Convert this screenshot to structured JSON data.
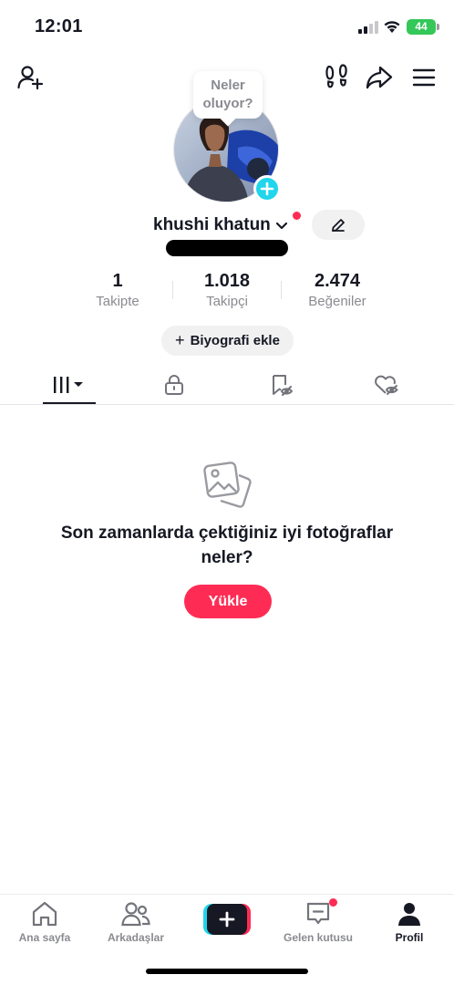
{
  "status_bar": {
    "time": "12:01",
    "battery": "44"
  },
  "header": {
    "icons": [
      "add-friend-icon",
      "footprint-icon",
      "share-icon",
      "menu-icon"
    ]
  },
  "profile": {
    "bubble_text": "Neler oluyor?",
    "username": "khushi khatun",
    "stats": {
      "following_count": "1",
      "following_label": "Takipte",
      "followers_count": "1.018",
      "followers_label": "Takipçi",
      "likes_count": "2.474",
      "likes_label": "Beğeniler"
    },
    "bio_button": "Biyografi ekle"
  },
  "tabs": {
    "items": [
      "videos",
      "private",
      "saved",
      "liked"
    ],
    "active": "videos"
  },
  "empty_state": {
    "message": "Son zamanlarda çektiğiniz iyi fotoğraflar neler?",
    "button": "Yükle"
  },
  "bottom_nav": {
    "home": "Ana sayfa",
    "friends": "Arkadaşlar",
    "inbox": "Gelen kutusu",
    "profile": "Profil",
    "active": "profile"
  },
  "colors": {
    "accent": "#fe2c55",
    "cyan": "#20d5ec",
    "text": "#161823",
    "muted": "#8a8b91"
  }
}
